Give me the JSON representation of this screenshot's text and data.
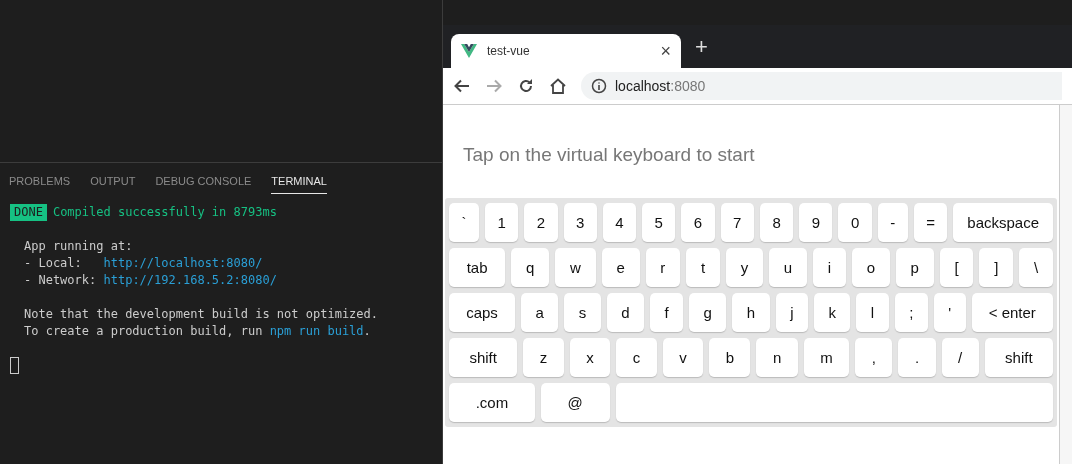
{
  "panel_tabs": [
    {
      "label": "PROBLEMS",
      "selected": false
    },
    {
      "label": "OUTPUT",
      "selected": false
    },
    {
      "label": "DEBUG CONSOLE",
      "selected": false
    },
    {
      "label": "TERMINAL",
      "selected": true
    }
  ],
  "terminal": {
    "badge": "DONE",
    "status": "Compiled successfully in 8793ms",
    "blocks": [
      [
        [
          {
            "kind": "text",
            "text": "App running at:"
          }
        ],
        [
          {
            "kind": "text",
            "text": "- Local:   "
          },
          {
            "kind": "link",
            "text": "http://localhost:8080/"
          }
        ],
        [
          {
            "kind": "text",
            "text": "- Network: "
          },
          {
            "kind": "link",
            "text": "http://192.168.5.2:8080/"
          }
        ]
      ],
      [
        [
          {
            "kind": "text",
            "text": "Note that the development build is not optimized."
          }
        ],
        [
          {
            "kind": "text",
            "text": "To create a production build, run "
          },
          {
            "kind": "link",
            "text": "npm run build"
          },
          {
            "kind": "text",
            "text": "."
          }
        ]
      ]
    ]
  },
  "browser": {
    "tab": {
      "title": "test-vue",
      "close": "×"
    },
    "new_tab": "+",
    "address": {
      "host": "localhost",
      "port": ":8080"
    }
  },
  "page": {
    "prompt": "Tap on the virtual keyboard to start"
  },
  "keyboard": {
    "key_rows": [
      {
        "keys": [
          {
            "kind": "char",
            "label": "`"
          },
          {
            "kind": "char",
            "label": "1"
          },
          {
            "kind": "char",
            "label": "2"
          },
          {
            "kind": "char",
            "label": "3"
          },
          {
            "kind": "char",
            "label": "4"
          },
          {
            "kind": "char",
            "label": "5"
          },
          {
            "kind": "char",
            "label": "6"
          },
          {
            "kind": "char",
            "label": "7"
          },
          {
            "kind": "char",
            "label": "8"
          },
          {
            "kind": "char",
            "label": "9"
          },
          {
            "kind": "char",
            "label": "0"
          },
          {
            "kind": "char",
            "label": "-"
          },
          {
            "kind": "char",
            "label": "="
          },
          {
            "kind": "action",
            "label": "backspace"
          }
        ]
      },
      {
        "keys": [
          {
            "kind": "action",
            "label": "tab"
          },
          {
            "kind": "char",
            "label": "q"
          },
          {
            "kind": "char",
            "label": "w"
          },
          {
            "kind": "char",
            "label": "e"
          },
          {
            "kind": "char",
            "label": "r"
          },
          {
            "kind": "char",
            "label": "t"
          },
          {
            "kind": "char",
            "label": "y"
          },
          {
            "kind": "char",
            "label": "u"
          },
          {
            "kind": "char",
            "label": "i"
          },
          {
            "kind": "char",
            "label": "o"
          },
          {
            "kind": "char",
            "label": "p"
          },
          {
            "kind": "char",
            "label": "["
          },
          {
            "kind": "char",
            "label": "]"
          },
          {
            "kind": "char",
            "label": "\\"
          }
        ]
      },
      {
        "keys": [
          {
            "kind": "action",
            "label": "caps"
          },
          {
            "kind": "char",
            "label": "a"
          },
          {
            "kind": "char",
            "label": "s"
          },
          {
            "kind": "char",
            "label": "d"
          },
          {
            "kind": "char",
            "label": "f"
          },
          {
            "kind": "char",
            "label": "g"
          },
          {
            "kind": "char",
            "label": "h"
          },
          {
            "kind": "char",
            "label": "j"
          },
          {
            "kind": "char",
            "label": "k"
          },
          {
            "kind": "char",
            "label": "l"
          },
          {
            "kind": "char",
            "label": ";"
          },
          {
            "kind": "char",
            "label": "'"
          },
          {
            "kind": "action",
            "label": "< enter"
          }
        ]
      },
      {
        "keys": [
          {
            "kind": "action",
            "label": "shift"
          },
          {
            "kind": "char",
            "label": "z"
          },
          {
            "kind": "char",
            "label": "x"
          },
          {
            "kind": "char",
            "label": "c"
          },
          {
            "kind": "char",
            "label": "v"
          },
          {
            "kind": "char",
            "label": "b"
          },
          {
            "kind": "char",
            "label": "n"
          },
          {
            "kind": "char",
            "label": "m"
          },
          {
            "kind": "char",
            "label": ","
          },
          {
            "kind": "char",
            "label": "."
          },
          {
            "kind": "char",
            "label": "/"
          },
          {
            "kind": "action",
            "label": "shift"
          }
        ]
      },
      {
        "keys": [
          {
            "kind": "action",
            "label": ".com"
          },
          {
            "kind": "action",
            "label": "@"
          },
          {
            "kind": "space"
          }
        ]
      }
    ]
  }
}
